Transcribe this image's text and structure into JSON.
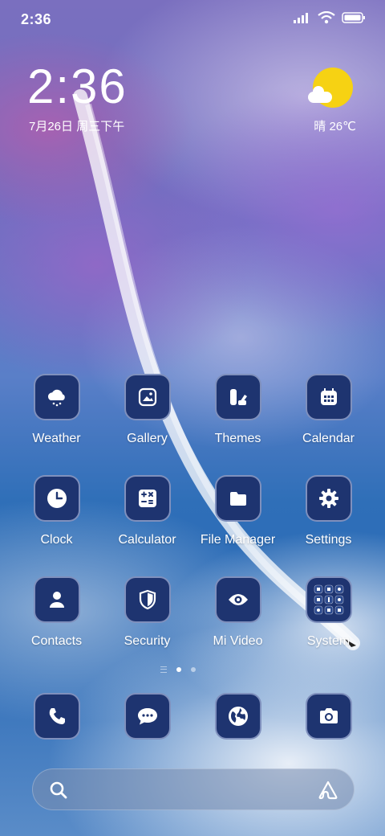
{
  "status_bar": {
    "time": "2:36",
    "icons": [
      "signal-icon",
      "wifi-icon",
      "battery-icon"
    ]
  },
  "lock_clock": {
    "time": "2:36",
    "date": "7月26日 周三下午"
  },
  "weather": {
    "condition_icon": "sun-cloud-icon",
    "text": "晴 26℃"
  },
  "apps": [
    {
      "label": "Weather",
      "icon": "weather-icon"
    },
    {
      "label": "Gallery",
      "icon": "gallery-icon"
    },
    {
      "label": "Themes",
      "icon": "themes-icon"
    },
    {
      "label": "Calendar",
      "icon": "calendar-icon"
    },
    {
      "label": "Clock",
      "icon": "clock-icon"
    },
    {
      "label": "Calculator",
      "icon": "calculator-icon"
    },
    {
      "label": "File Manager",
      "icon": "folder-icon"
    },
    {
      "label": "Settings",
      "icon": "gear-icon"
    },
    {
      "label": "Contacts",
      "icon": "person-icon"
    },
    {
      "label": "Security",
      "icon": "shield-icon"
    },
    {
      "label": "Mi Video",
      "icon": "eye-icon"
    },
    {
      "label": "System",
      "icon": "folder-grid-icon"
    }
  ],
  "page_indicator": {
    "pages": 2,
    "active": 1
  },
  "dock": [
    {
      "icon": "phone-icon"
    },
    {
      "icon": "message-icon"
    },
    {
      "icon": "globe-icon"
    },
    {
      "icon": "camera-icon"
    }
  ],
  "search_bar": {
    "placeholder": "",
    "left_icon": "search-icon",
    "right_icon": "assistant-icon"
  },
  "colors": {
    "icon_bg": "#1e3470",
    "sun": "#f6d213"
  }
}
